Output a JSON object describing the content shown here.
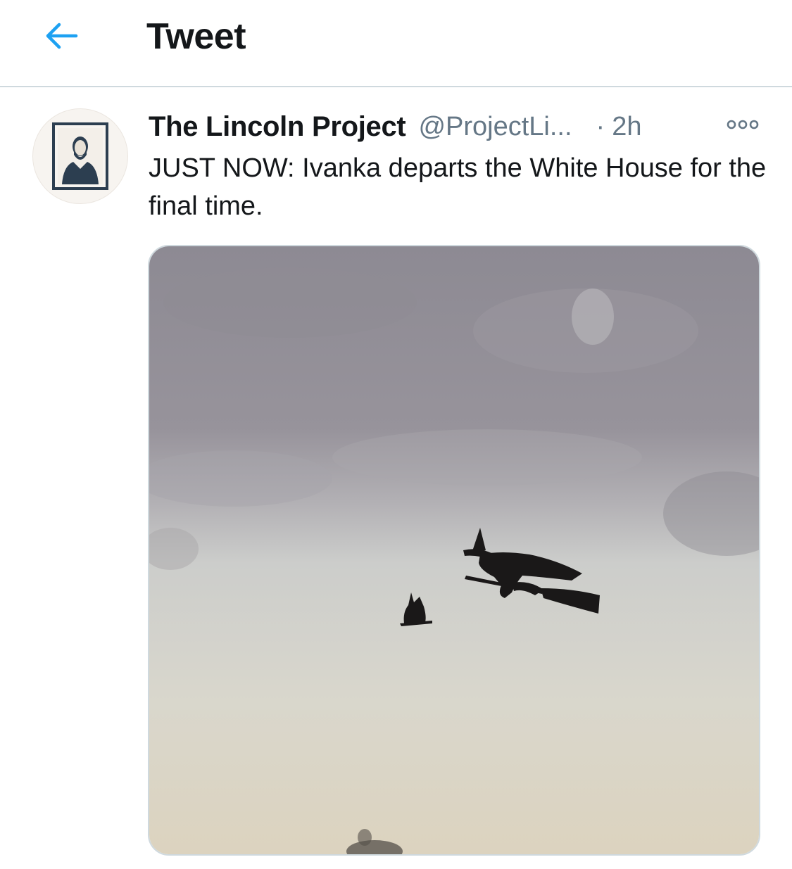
{
  "header": {
    "back_icon": "arrow-left-icon",
    "title": "Tweet"
  },
  "tweet": {
    "avatar_icon": "lincoln-portrait-avatar",
    "display_name": "The Lincoln Project",
    "handle": "@ProjectLi...",
    "separator": "·",
    "time": "2h",
    "more_icon": "more-options-icon",
    "text": "JUST NOW: Ivanka departs the White House for the final time.",
    "media": {
      "kind": "video-still",
      "description_icon": "witch-on-broom-silhouette"
    }
  },
  "colors": {
    "accent": "#1da1f2",
    "text_primary": "#14171a",
    "text_secondary": "#657786",
    "divider": "#cfd9de"
  }
}
